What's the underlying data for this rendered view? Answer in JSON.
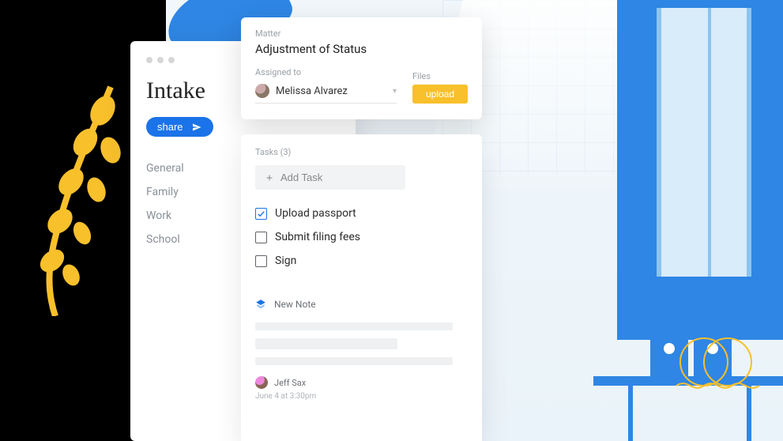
{
  "sidebar": {
    "title": "Intake",
    "share_label": "share",
    "nav": [
      "General",
      "Family",
      "Work",
      "School"
    ]
  },
  "matter": {
    "matter_label": "Matter",
    "matter_value": "Adjustment of Status",
    "assigned_label": "Assigned to",
    "assigned_value": "Melissa Alvarez",
    "files_label": "Files",
    "upload_label": "upload"
  },
  "tasks": {
    "header": "Tasks (3)",
    "add_label": "Add Task",
    "items": [
      {
        "label": "Upload passport",
        "checked": true
      },
      {
        "label": "Submit filing fees",
        "checked": false
      },
      {
        "label": "Sign",
        "checked": false
      }
    ]
  },
  "note": {
    "new_label": "New Note",
    "author": "Jeff Sax",
    "timestamp": "June 4 at 3:30pm"
  }
}
